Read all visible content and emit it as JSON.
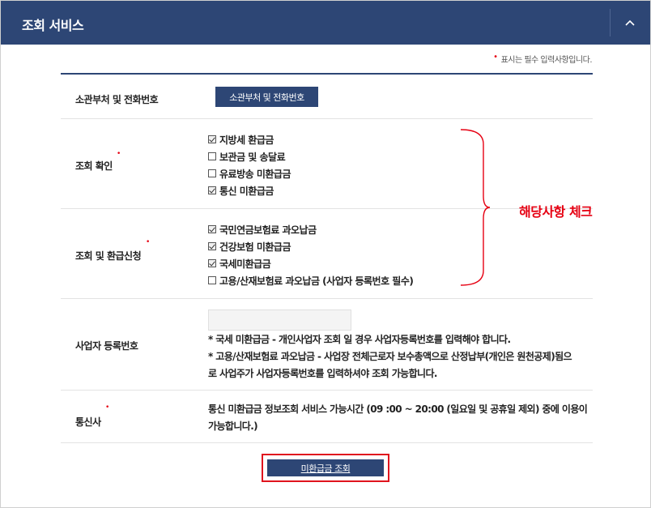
{
  "header": {
    "title": "조회 서비스",
    "collapse_icon": "chevron-up-icon"
  },
  "required_note": {
    "marker": "•",
    "text": "표시는 필수 입력사항입니다."
  },
  "rows": {
    "dept": {
      "label": "소관부처 및 전화번호",
      "button": "소관부처 및 전화번호"
    },
    "inquiry": {
      "label": "조회 확인",
      "required": "•",
      "items": [
        {
          "label": "지방세 환급금",
          "checked": true
        },
        {
          "label": "보관금 및 송달료",
          "checked": false
        },
        {
          "label": "유료방송 미환급금",
          "checked": false
        },
        {
          "label": "통신 미환급금",
          "checked": true
        }
      ]
    },
    "refund": {
      "label": "조회 및 환급신청",
      "required": "•",
      "items": [
        {
          "label": "국민연금보험료 과오납금",
          "checked": true
        },
        {
          "label": "건강보험 미환급금",
          "checked": true
        },
        {
          "label": "국세미환급금",
          "checked": true
        },
        {
          "label": "고용/산재보험료 과오납금 (사업자 등록번호 필수)",
          "checked": false
        }
      ]
    },
    "business": {
      "label": "사업자 등록번호",
      "input_value": "",
      "note1": "* 국세 미환급금 - 개인사업자 조회 일 경우 사업자등록번호를 입력해야 합니다.",
      "note2a": "* 고용/산재보험료 과오납금 - 사업장 전체근로자 보수총액으로 산정납부(개인은 원천공제)됨으",
      "note2b": "로 사업주가 사업자등록번호를 입력하셔야 조회 가능합니다."
    },
    "telecom": {
      "label": "통신사",
      "required": "•",
      "note_a": "통신 미환급금 정보조회 서비스 가능시간 (09 :00 ~ 20:00 (일요일 및 공휴일 제외) 중에 이용이",
      "note_b": "가능합니다.)"
    }
  },
  "annotation": "해당사항 체크",
  "submit": {
    "label": "미환급금 조회"
  },
  "colors": {
    "header": "#2d4675",
    "required": "#e60012",
    "highlight": "#e0141e"
  }
}
